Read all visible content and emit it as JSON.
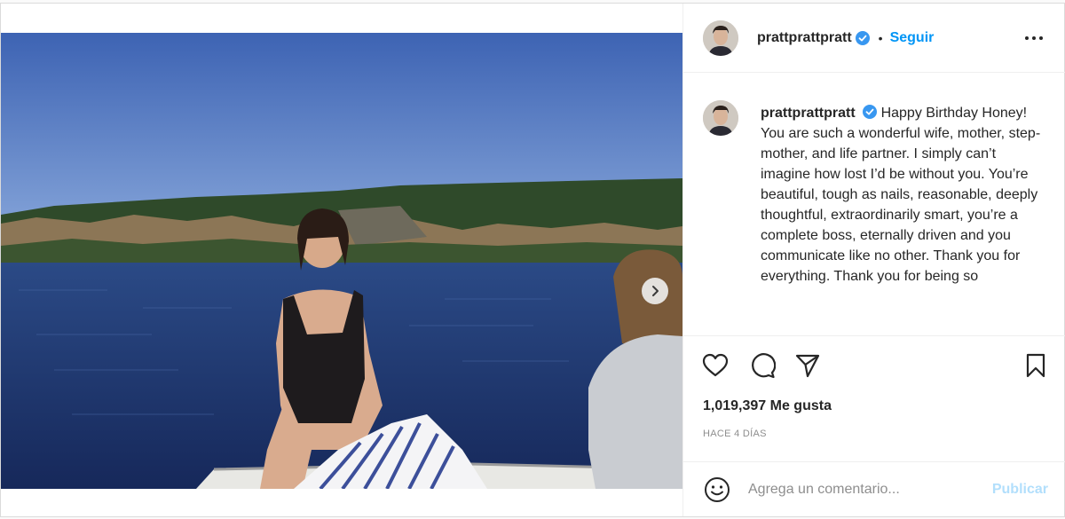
{
  "header": {
    "username": "prattprattpratt",
    "separator": "•",
    "follow_label": "Seguir",
    "avatar_icon": "profile-avatar",
    "more_icon": "more-options-icon"
  },
  "caption": {
    "username": "prattprattpratt",
    "text": "Happy Birthday Honey!\nYou are such a wonderful wife, mother, step-mother, and life partner. I simply can’t imagine how lost I’d be without you. You’re beautiful, tough as nails, reasonable, deeply thoughtful, extraordinarily smart, you’re a complete boss, eternally driven and you communicate like no other. Thank you for everything. Thank you for being so"
  },
  "actions": {
    "like_icon": "heart-icon",
    "comment_icon": "comment-icon",
    "share_icon": "paper-plane-icon",
    "save_icon": "bookmark-icon"
  },
  "likes": {
    "text": "1,019,397 Me gusta"
  },
  "timestamp": "HACE 4 DÍAS",
  "comment": {
    "placeholder": "Agrega un comentario...",
    "publish_label": "Publicar",
    "emoji_icon": "smiley-icon"
  },
  "media": {
    "next_icon": "chevron-right-icon"
  },
  "colors": {
    "accent": "#0095f6",
    "publish_disabled": "#b2dffc",
    "verified": "#3897f0",
    "muted_text": "#8e8e8e"
  }
}
